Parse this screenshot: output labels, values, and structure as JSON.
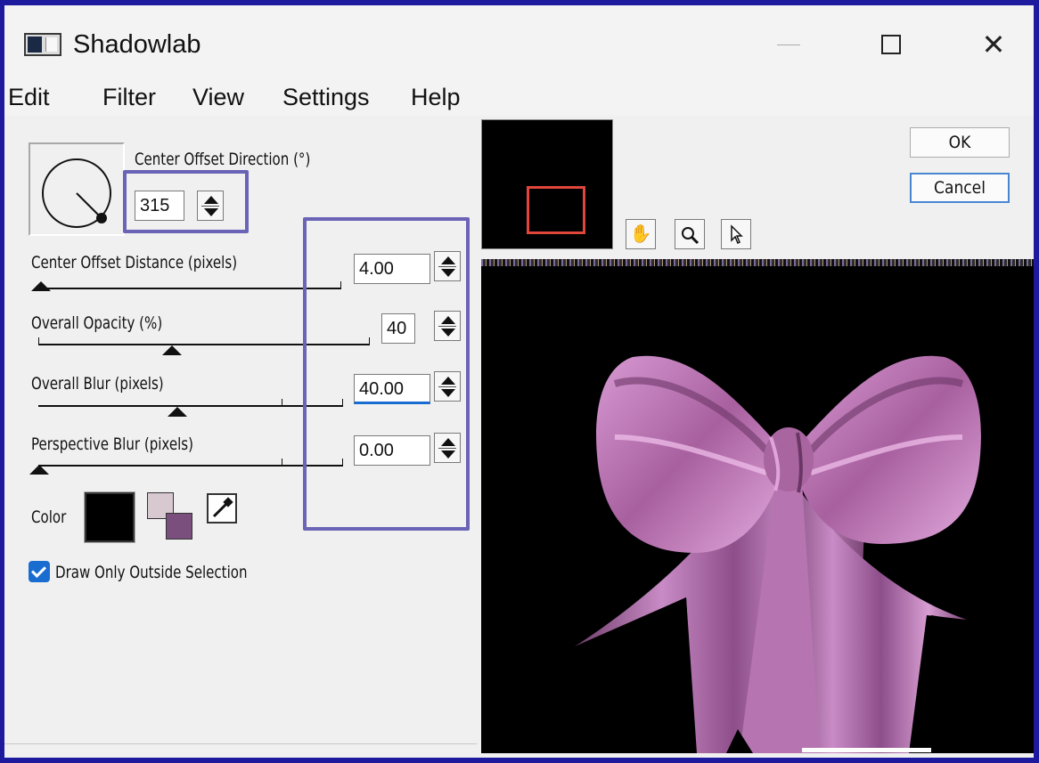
{
  "window": {
    "title": "Shadowlab",
    "controls": {
      "minimize": "minimize-icon",
      "maximize": "maximize-icon",
      "close": "close-icon"
    }
  },
  "menu": [
    "Edit",
    "Filter",
    "View",
    "Settings",
    "Help"
  ],
  "controls": {
    "direction": {
      "label": "Center Offset Direction (°)",
      "value": "315"
    },
    "distance": {
      "label": "Center Offset Distance (pixels)",
      "value": "4.00",
      "slider_fraction": 0.02
    },
    "opacity": {
      "label": "Overall Opacity (%)",
      "value": "40",
      "slider_fraction": 0.4
    },
    "blur": {
      "label": "Overall Blur (pixels)",
      "value": "40.00",
      "slider_fraction": 0.45
    },
    "perspective": {
      "label": "Perspective Blur (pixels)",
      "value": "0.00",
      "slider_fraction": 0.0
    },
    "color_label": "Color",
    "colors": {
      "shadow": "#000000",
      "background": "#d8c8d0",
      "foreground": "#7b4f7d"
    },
    "draw_outside": {
      "label": "Draw Only Outside Selection",
      "checked": true
    }
  },
  "buttons": {
    "ok": "OK",
    "cancel": "Cancel"
  },
  "tools": [
    "hand-icon",
    "zoom-icon",
    "pointer-icon"
  ],
  "accent": "#1a6dd0",
  "highlight_color": "#6a63b6"
}
